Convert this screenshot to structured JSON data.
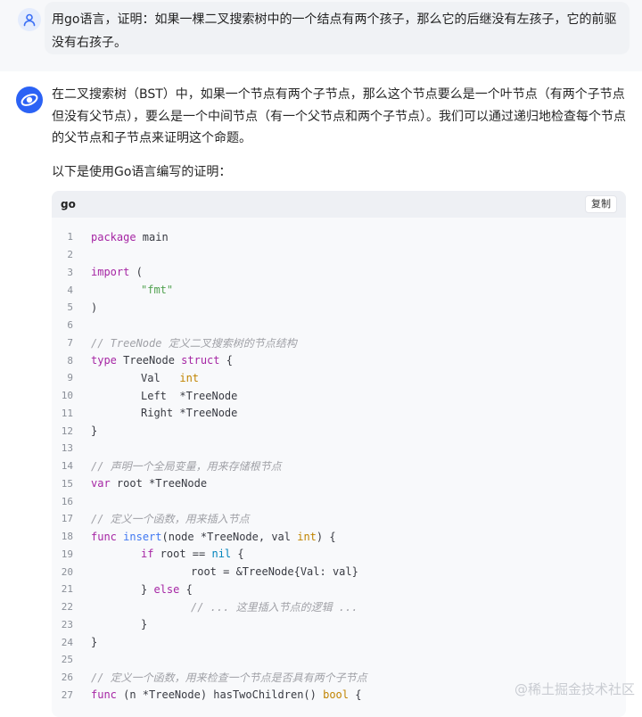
{
  "user": {
    "message": "用go语言，证明：如果一棵二叉搜索树中的一个结点有两个孩子，那么它的后继没有左孩子，它的前驱没有右孩子。"
  },
  "answer": {
    "paragraph1": "在二叉搜索树（BST）中，如果一个节点有两个子节点，那么这个节点要么是一个叶节点（有两个子节点但没有父节点），要么是一个中间节点（有一个父节点和两个子节点）。我们可以通过递归地检查每个节点的父节点和子节点来证明这个命题。",
    "paragraph2": "以下是使用Go语言编写的证明："
  },
  "code": {
    "language": "go",
    "copy_label": "复制",
    "line_numbers": [
      "1",
      "2",
      "3",
      "4",
      "5",
      "6",
      "7",
      "8",
      "9",
      "10",
      "11",
      "12",
      "13",
      "14",
      "15",
      "16",
      "17",
      "18",
      "19",
      "20",
      "21",
      "22",
      "23",
      "24",
      "25",
      "26",
      "27"
    ],
    "tokens": {
      "package": "package",
      "main": " main",
      "import": "import",
      "paren_open": " (",
      "fmt": "\"fmt\"",
      "paren_close": ")",
      "c7": "// TreeNode 定义二叉搜索树的节点结构",
      "type": "type",
      "treenode_struct": " TreeNode ",
      "struct": "struct",
      "brace_open": " {",
      "val": "Val   ",
      "int": "int",
      "left": "Left  *TreeNode",
      "right": "Right *TreeNode",
      "brace_close": "}",
      "c14": "// 声明一个全局变量，用来存储根节点",
      "var": "var",
      "root_decl": " root *TreeNode",
      "c17": "// 定义一个函数，用来插入节点",
      "func": "func",
      "insert": "insert",
      "insert_args1": "(node *TreeNode, val ",
      "insert_args2": ") {",
      "if": "if",
      "root_eq": " root == ",
      "nil": "nil",
      "root_assign": "root = &TreeNode{Val: val}",
      "else_open": "} ",
      "else": "else",
      "c22": "// ... 这里插入节点的逻辑 ...",
      "c26": "// 定义一个函数，用来检查一个节点是否具有两个子节点",
      "method_recv": " (n *TreeNode) hasTwoChildren() ",
      "bool": "bool"
    }
  },
  "watermark": "@稀土掘金技术社区",
  "colors": {
    "accent": "#2b62f5",
    "keyword": "#a626a4",
    "string": "#50a14f",
    "type": "#c18401",
    "comment": "#a0a1a7"
  }
}
